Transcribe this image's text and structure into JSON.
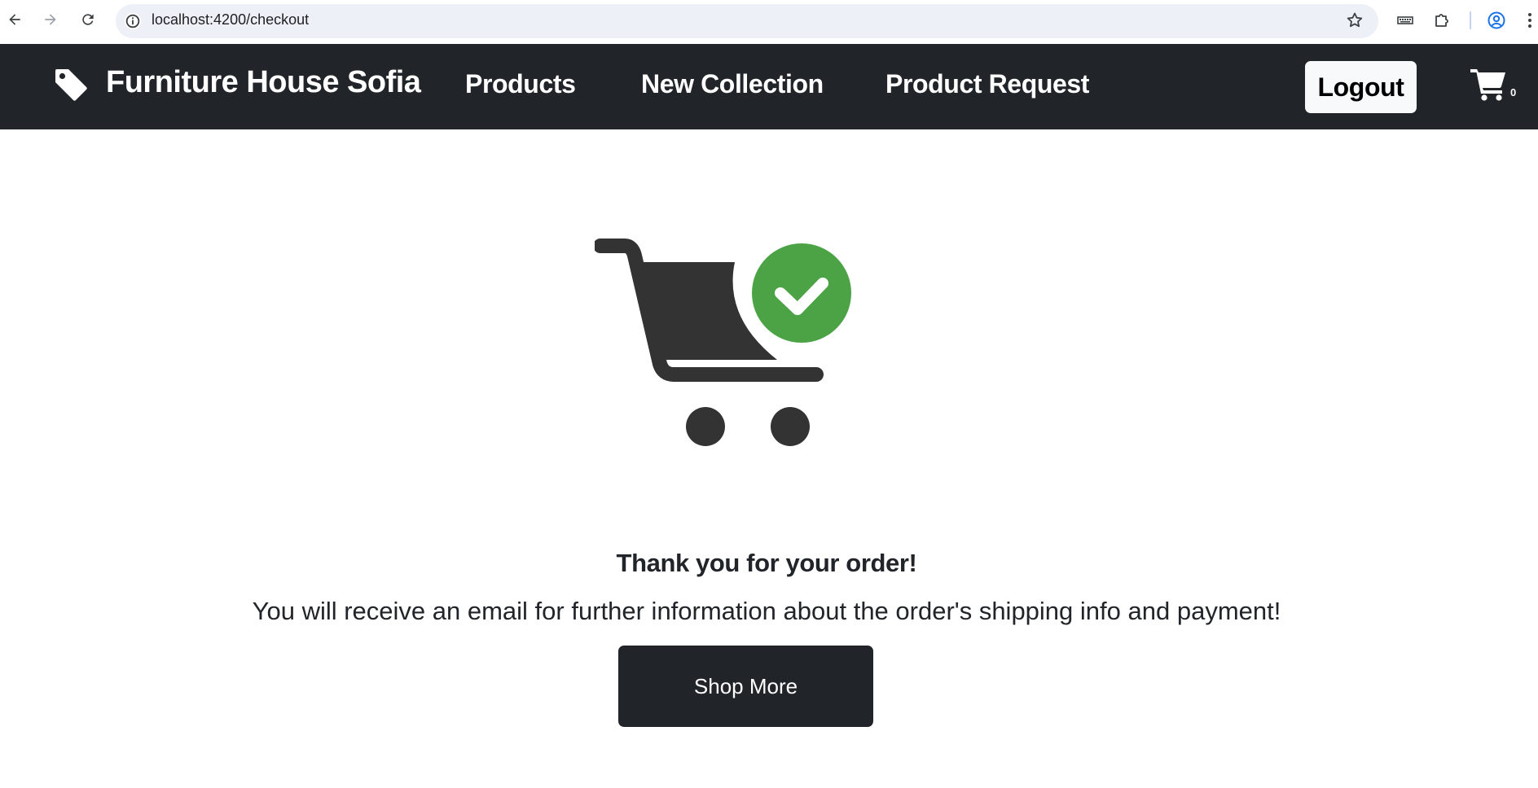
{
  "browser": {
    "url": "localhost:4200/checkout",
    "icons": [
      "back-arrow-icon",
      "forward-arrow-icon",
      "reload-icon",
      "site-info-icon",
      "bookmark-star-icon",
      "extension-icon",
      "puzzle-icon",
      "profile-icon",
      "more-vert-icon"
    ]
  },
  "navbar": {
    "brand": "Furniture House Sofia",
    "brand_icon": "tag-icon",
    "links": [
      {
        "label": "Products"
      },
      {
        "label": "New Collection"
      },
      {
        "label": "Product Request"
      }
    ],
    "logout_label": "Logout",
    "cart_icon": "shopping-cart-icon",
    "cart_count": "0",
    "background_color": "#212529"
  },
  "main": {
    "illustration": "cart-success-icon",
    "check_color": "#4ba345",
    "cart_color": "#333333",
    "title": "Thank you for your order!",
    "message": "You will receive an email for further information about the order's shipping info and payment!",
    "shop_more_label": "Shop More"
  }
}
